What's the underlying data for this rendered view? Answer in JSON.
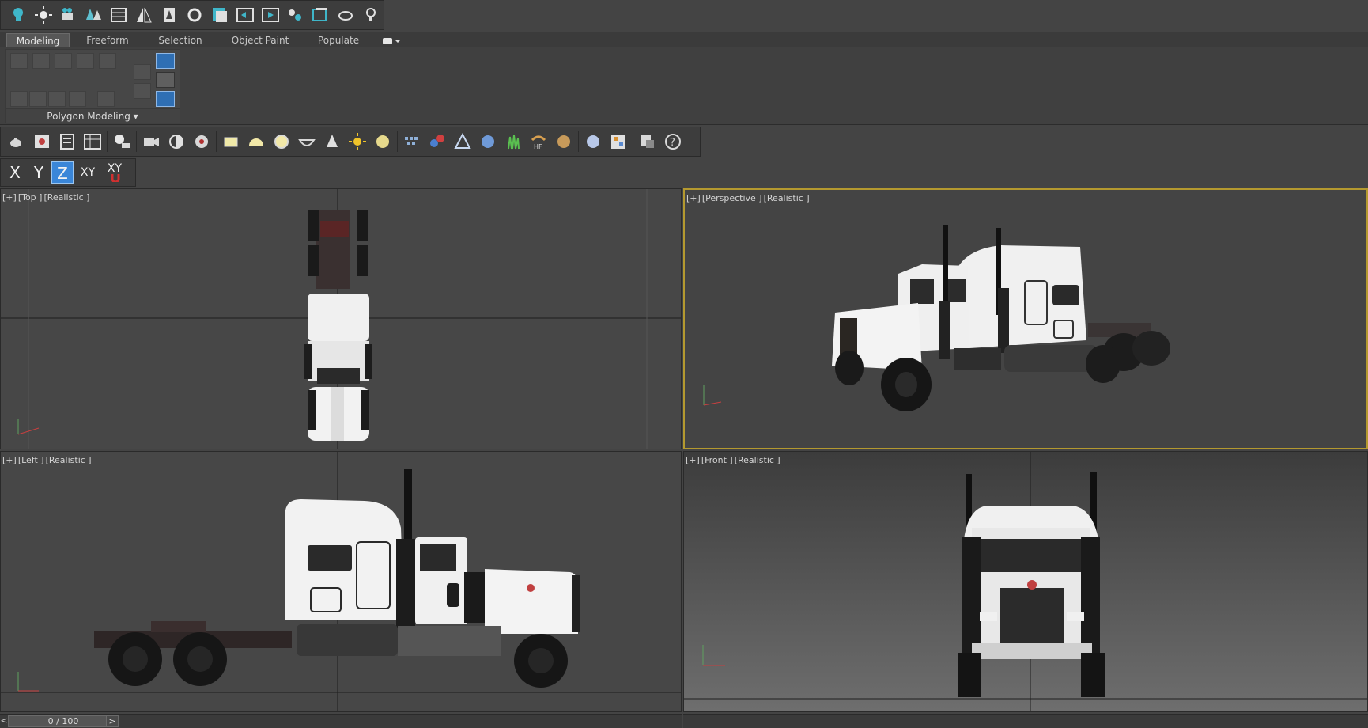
{
  "main_toolbar": {
    "icons": [
      "light-bulb-icon",
      "sun-icon",
      "camera-icon",
      "trees-icon",
      "grid-list-icon",
      "mirror-icon",
      "tree-icon",
      "rotate-icon",
      "layer-icon",
      "align-icon",
      "render-frame-icon",
      "render-setup-icon",
      "viewport-icon",
      "teapot-render-icon",
      "lightbulb-outline-icon"
    ]
  },
  "ribbon": {
    "tabs": [
      "Modeling",
      "Freeform",
      "Selection",
      "Object Paint",
      "Populate"
    ],
    "active_tab": "Modeling",
    "group_label": "Polygon Modeling ▾"
  },
  "create_toolbar": {
    "icons": [
      "teapot-icon",
      "render-frame-icon",
      "list-icon",
      "table-icon",
      "light-icon",
      "camera-icon",
      "half-sphere-icon",
      "film-icon",
      "plane-icon",
      "dome-icon",
      "sphere-icon",
      "bowl-icon",
      "cone-icon",
      "sun-icon",
      "disc-icon",
      "grid-icon",
      "molecule-icon",
      "tent-icon",
      "particles-icon",
      "grass-icon",
      "hair-icon",
      "fur-icon",
      "globe-icon",
      "material-icon",
      "layers-icon",
      "help-icon"
    ]
  },
  "axis_toolbar": {
    "x": "X",
    "y": "Y",
    "z": "Z",
    "xy": "XY",
    "xy_snap": "XY"
  },
  "viewports": {
    "top": [
      "[+]",
      "[Top ]",
      "[Realistic ]"
    ],
    "perspective": [
      "[+]",
      "[Perspective ]",
      "[Realistic ]"
    ],
    "left": [
      "[+]",
      "[Left ]",
      "[Realistic ]"
    ],
    "front": [
      "[+]",
      "[Front ]",
      "[Realistic ]"
    ]
  },
  "time_slider": {
    "prev": "<",
    "value": "0 / 100",
    "next": ">"
  },
  "colors": {
    "active_viewport_border": "#b4992f",
    "axis_active": "#3a86d8",
    "truck_body": "#f2f2f2"
  }
}
